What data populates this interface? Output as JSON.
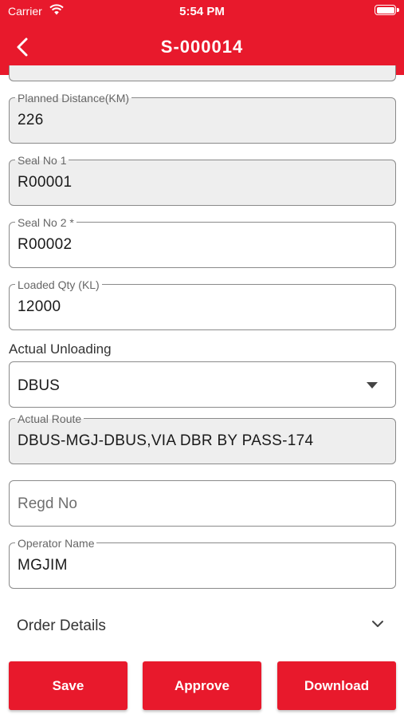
{
  "status_bar": {
    "carrier": "Carrier",
    "time": "5:54 PM"
  },
  "header": {
    "title": "S-000014"
  },
  "colors": {
    "accent": "#e8192c",
    "disabled_field": "#eeeeee",
    "border": "#8a8a8a"
  },
  "form": {
    "planned_distance": {
      "label": "Planned Distance(KM)",
      "value": "226"
    },
    "seal_no_1": {
      "label": "Seal No 1",
      "value": "R00001"
    },
    "seal_no_2": {
      "label": "Seal No 2 *",
      "value": "R00002"
    },
    "loaded_qty": {
      "label": "Loaded Qty (KL)",
      "value": "12000"
    },
    "actual_unloading": {
      "label": "Actual Unloading",
      "value": "DBUS"
    },
    "actual_route": {
      "label": "Actual Route",
      "value": "DBUS-MGJ-DBUS,VIA DBR BY PASS-174"
    },
    "regd_no": {
      "placeholder": "Regd No"
    },
    "operator_name": {
      "label": "Operator Name",
      "value": "MGJIM"
    }
  },
  "order_details": {
    "label": "Order Details"
  },
  "buttons": {
    "save": "Save",
    "approve": "Approve",
    "download": "Download"
  }
}
